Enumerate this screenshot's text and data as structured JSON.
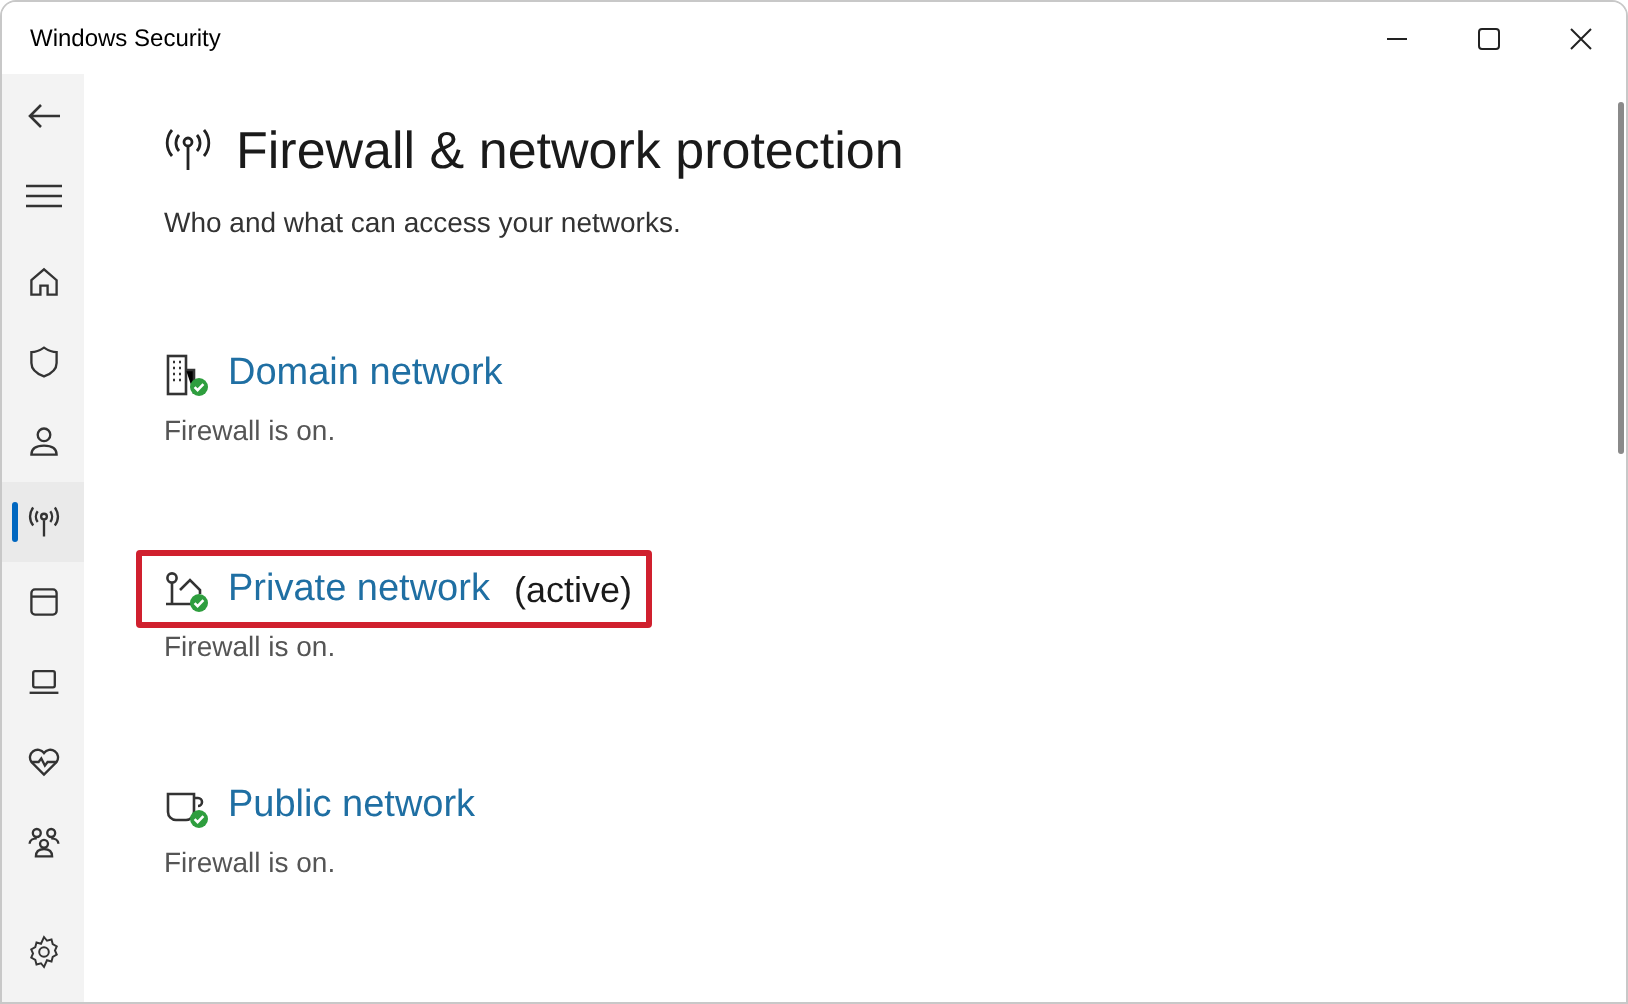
{
  "window": {
    "title": "Windows Security"
  },
  "sidebar": {
    "items": [
      {
        "kind": "home",
        "selected": false
      },
      {
        "kind": "shield",
        "selected": false
      },
      {
        "kind": "person",
        "selected": false
      },
      {
        "kind": "antenna",
        "selected": true
      },
      {
        "kind": "window",
        "selected": false
      },
      {
        "kind": "laptop",
        "selected": false
      },
      {
        "kind": "heart",
        "selected": false
      },
      {
        "kind": "family",
        "selected": false
      }
    ]
  },
  "page": {
    "title": "Firewall & network protection",
    "subtitle": "Who and what can access your networks."
  },
  "networks": [
    {
      "kind": "domain",
      "name": "Domain network",
      "status": "Firewall is on.",
      "highlighted": false
    },
    {
      "kind": "private",
      "name": "Private network",
      "active_label": "(active)",
      "status": "Firewall is on.",
      "highlighted": true
    },
    {
      "kind": "public",
      "name": "Public network",
      "status": "Firewall is on.",
      "highlighted": false
    }
  ]
}
